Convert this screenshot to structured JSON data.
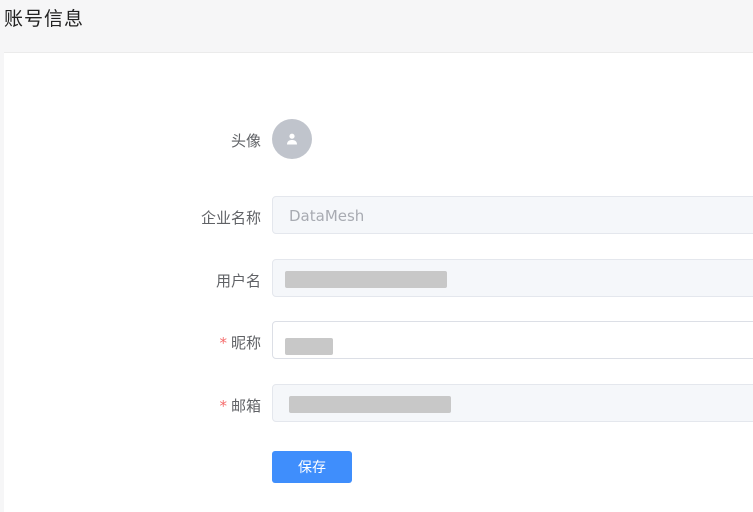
{
  "page": {
    "title": "账号信息"
  },
  "form": {
    "avatar_label": "头像",
    "company_label": "企业名称",
    "company_value": "DataMesh",
    "username_label": "用户名",
    "nickname_required": "*",
    "nickname_label": "昵称",
    "email_required": "*",
    "email_label": "邮箱"
  },
  "actions": {
    "save_label": "保存"
  },
  "colors": {
    "primary": "#3f8efc",
    "required": "#f56c6c",
    "avatar_bg": "#c0c4cc"
  },
  "icons": {
    "avatar": "user-icon"
  }
}
